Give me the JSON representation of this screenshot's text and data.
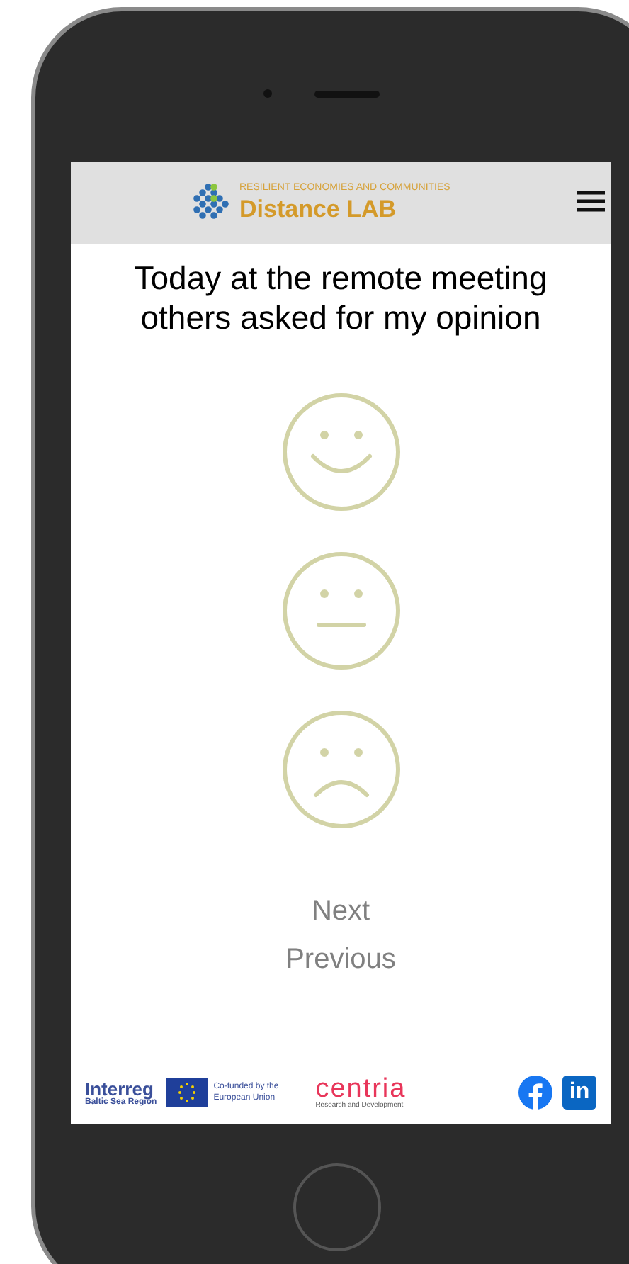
{
  "header": {
    "tagline": "RESILIENT ECONOMIES AND COMMUNITIES",
    "brand": "Distance LAB"
  },
  "question": "Today at the remote meeting others asked for my opinion",
  "answers": [
    {
      "kind": "happy"
    },
    {
      "kind": "neutral"
    },
    {
      "kind": "sad"
    }
  ],
  "nav": [
    "Next",
    "Previous"
  ],
  "footer": {
    "interreg": "Interreg",
    "interreg_sub": "Baltic Sea Region",
    "eu": "Co-funded by the European Union",
    "centria": "centria",
    "centria_sub": "Research and Development",
    "linkedin": "in"
  }
}
